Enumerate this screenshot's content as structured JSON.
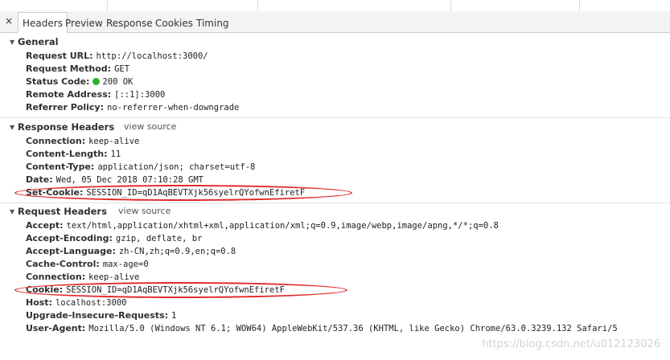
{
  "tabs": [
    "Headers",
    "Preview",
    "Response",
    "Cookies",
    "Timing"
  ],
  "close_icon": "×",
  "general": {
    "title": "General",
    "rows": [
      {
        "key": "Request URL:",
        "value": "http://localhost:3000/"
      },
      {
        "key": "Request Method:",
        "value": "GET"
      },
      {
        "key": "Status Code:",
        "value": "200 OK",
        "status_color": "#2db32d"
      },
      {
        "key": "Remote Address:",
        "value": "[::1]:3000"
      },
      {
        "key": "Referrer Policy:",
        "value": "no-referrer-when-downgrade"
      }
    ]
  },
  "response_headers": {
    "title": "Response Headers",
    "view_source": "view source",
    "rows": [
      {
        "key": "Connection:",
        "value": "keep-alive"
      },
      {
        "key": "Content-Length:",
        "value": "11"
      },
      {
        "key": "Content-Type:",
        "value": "application/json; charset=utf-8"
      },
      {
        "key": "Date:",
        "value": "Wed, 05 Dec 2018 07:10:28 GMT"
      },
      {
        "key": "Set-Cookie:",
        "value": "SESSION_ID=qD1AqBEVTXjk56syelrQYofwnEfiretF"
      }
    ]
  },
  "request_headers": {
    "title": "Request Headers",
    "view_source": "view source",
    "rows": [
      {
        "key": "Accept:",
        "value": "text/html,application/xhtml+xml,application/xml;q=0.9,image/webp,image/apng,*/*;q=0.8"
      },
      {
        "key": "Accept-Encoding:",
        "value": "gzip, deflate, br"
      },
      {
        "key": "Accept-Language:",
        "value": "zh-CN,zh;q=0.9,en;q=0.8"
      },
      {
        "key": "Cache-Control:",
        "value": "max-age=0"
      },
      {
        "key": "Connection:",
        "value": "keep-alive"
      },
      {
        "key": "Cookie:",
        "value": "SESSION_ID=qD1AqBEVTXjk56syelrQYofwnEfiretF"
      },
      {
        "key": "Host:",
        "value": "localhost:3000"
      },
      {
        "key": "Upgrade-Insecure-Requests:",
        "value": "1"
      },
      {
        "key": "User-Agent:",
        "value": "Mozilla/5.0 (Windows NT 6.1; WOW64) AppleWebKit/537.36 (KHTML, like Gecko) Chrome/63.0.3239.132 Safari/5"
      }
    ]
  },
  "watermark": "https://blog.csdn.net/u012123026",
  "highlight_color": "#e02a2a"
}
